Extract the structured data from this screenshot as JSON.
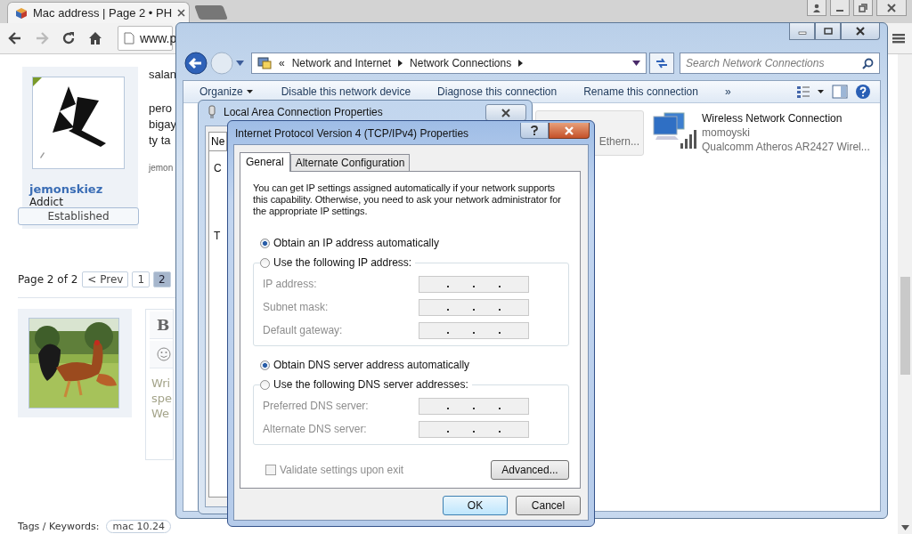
{
  "browser": {
    "tab": {
      "title": "Mac address | Page 2 • PH"
    },
    "url": "www.p",
    "post": {
      "lines": [
        "salan",
        "pero",
        "bigay",
        "ty ta"
      ],
      "signature": "jemon"
    },
    "user": {
      "name": "jemonskiez",
      "rank": "Addict",
      "badge": "Established"
    },
    "pagination": {
      "label": "Page 2 of 2",
      "prev": "< Prev",
      "pages": [
        {
          "label": "1",
          "selected": false
        },
        {
          "label": "2",
          "selected": true
        }
      ]
    },
    "editor": {
      "bold": "B",
      "placeholder_lines": [
        "Wri",
        "spe",
        "We"
      ]
    },
    "tags": {
      "label": "Tags / Keywords:",
      "items": [
        "mac 10.24"
      ]
    }
  },
  "explorer": {
    "breadcrumb": [
      "«",
      "Network and Internet",
      "Network Connections"
    ],
    "search": {
      "placeholder": "Search Network Connections"
    },
    "toolbar": [
      "Organize",
      "Disable this network device",
      "Diagnose this connection",
      "Rename this connection",
      "»"
    ],
    "connections": [
      {
        "kind": "ethernet",
        "selected": true,
        "adapter": "Ethern..."
      },
      {
        "kind": "wireless",
        "selected": false,
        "name": "Wireless Network Connection",
        "network": "momoyski",
        "adapter": "Qualcomm Atheros AR2427 Wirel..."
      }
    ]
  },
  "lac_window": {
    "title": "Local Area Connection Properties",
    "tab": "Ne",
    "labels": [
      "C",
      "T"
    ]
  },
  "ipv4_dialog": {
    "title": "Internet Protocol Version 4 (TCP/IPv4) Properties",
    "tabs": [
      {
        "label": "General",
        "selected": true
      },
      {
        "label": "Alternate Configuration",
        "selected": false
      }
    ],
    "intro": "You can get IP settings assigned automatically if your network supports this capability. Otherwise, you need to ask your network administrator for the appropriate IP settings.",
    "ip_mode": [
      {
        "label": "Obtain an IP address automatically",
        "selected": true
      },
      {
        "label": "Use the following IP address:",
        "selected": false
      }
    ],
    "ip_fields": [
      {
        "label": "IP address:",
        "disabled": true
      },
      {
        "label": "Subnet mask:",
        "disabled": true
      },
      {
        "label": "Default gateway:",
        "disabled": true
      }
    ],
    "dns_mode": [
      {
        "label": "Obtain DNS server address automatically",
        "selected": true
      },
      {
        "label": "Use the following DNS server addresses:",
        "selected": false
      }
    ],
    "dns_fields": [
      {
        "label": "Preferred DNS server:",
        "disabled": true
      },
      {
        "label": "Alternate DNS server:",
        "disabled": true
      }
    ],
    "validate": {
      "label": "Validate settings upon exit",
      "checked": false,
      "disabled": true
    },
    "buttons": {
      "advanced": "Advanced...",
      "ok": "OK",
      "cancel": "Cancel"
    }
  }
}
